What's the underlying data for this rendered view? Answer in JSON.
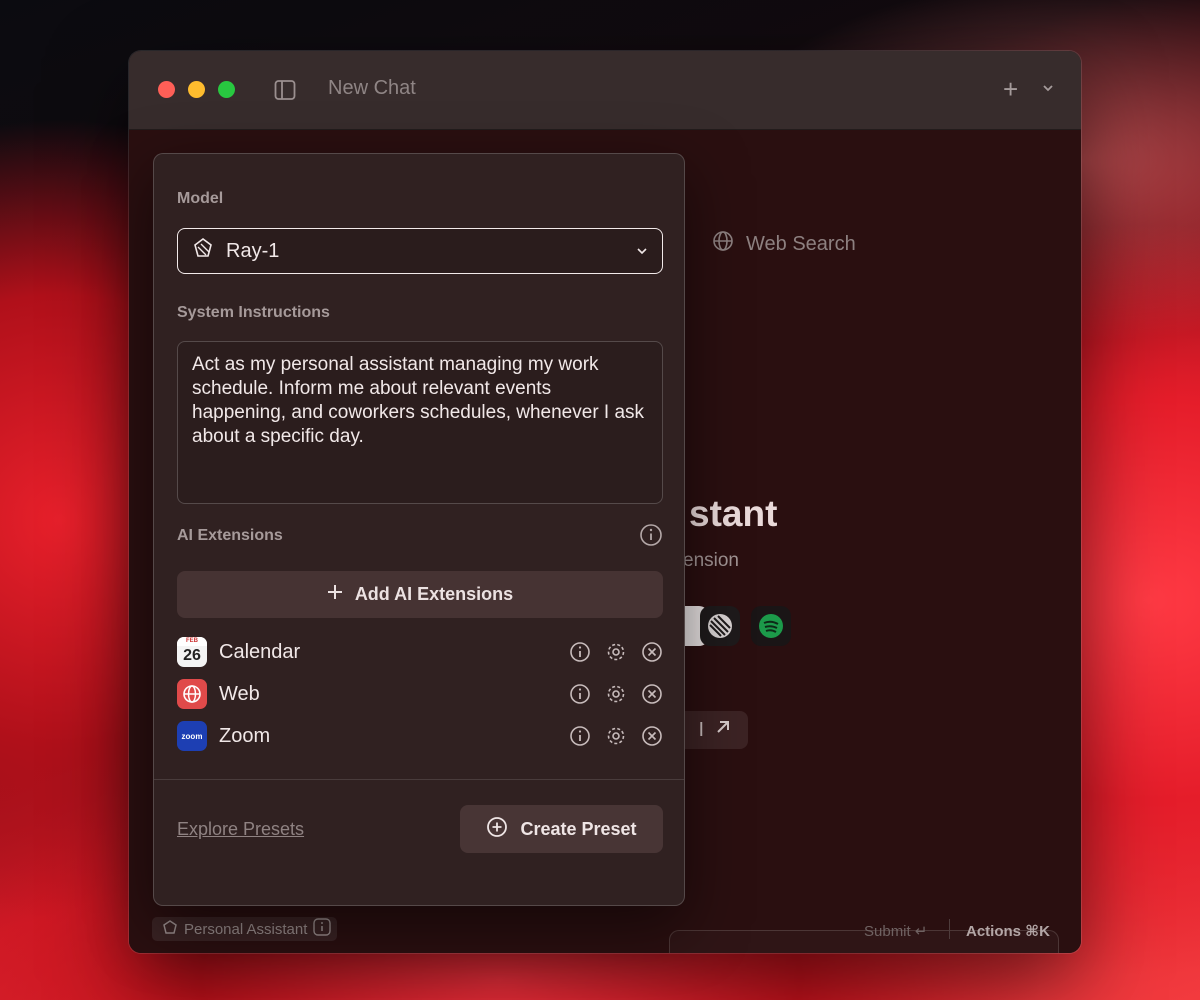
{
  "window": {
    "title": "New Chat",
    "new_button": "+"
  },
  "background": {
    "web_search_label": "Web Search",
    "heading_fragment": "stant",
    "subtitle_fragment": "ension",
    "button_fragment": "I"
  },
  "panel": {
    "model_label": "Model",
    "model_value": "Ray-1",
    "system_label": "System Instructions",
    "system_text": "Act as my personal assistant managing my work schedule. Inform me about relevant events happening, and coworkers schedules, whenever I ask about a specific day.",
    "extensions_label": "AI Extensions",
    "add_extensions_label": "Add AI Extensions",
    "extensions": [
      {
        "name": "Calendar",
        "icon": "calendar-icon",
        "month": "FEB",
        "day": "26"
      },
      {
        "name": "Web",
        "icon": "globe-icon"
      },
      {
        "name": "Zoom",
        "icon": "zoom-icon",
        "logo_text": "zoom"
      }
    ],
    "explore_label": "Explore Presets",
    "create_label": "Create Preset"
  },
  "bottom_bar": {
    "preset_name": "Personal Assistant",
    "submit_label": "Submit ↵",
    "actions_label": "Actions ⌘K"
  },
  "colors": {
    "close": "#fe5f57",
    "minimize": "#febc2e",
    "zoom": "#28c840"
  }
}
